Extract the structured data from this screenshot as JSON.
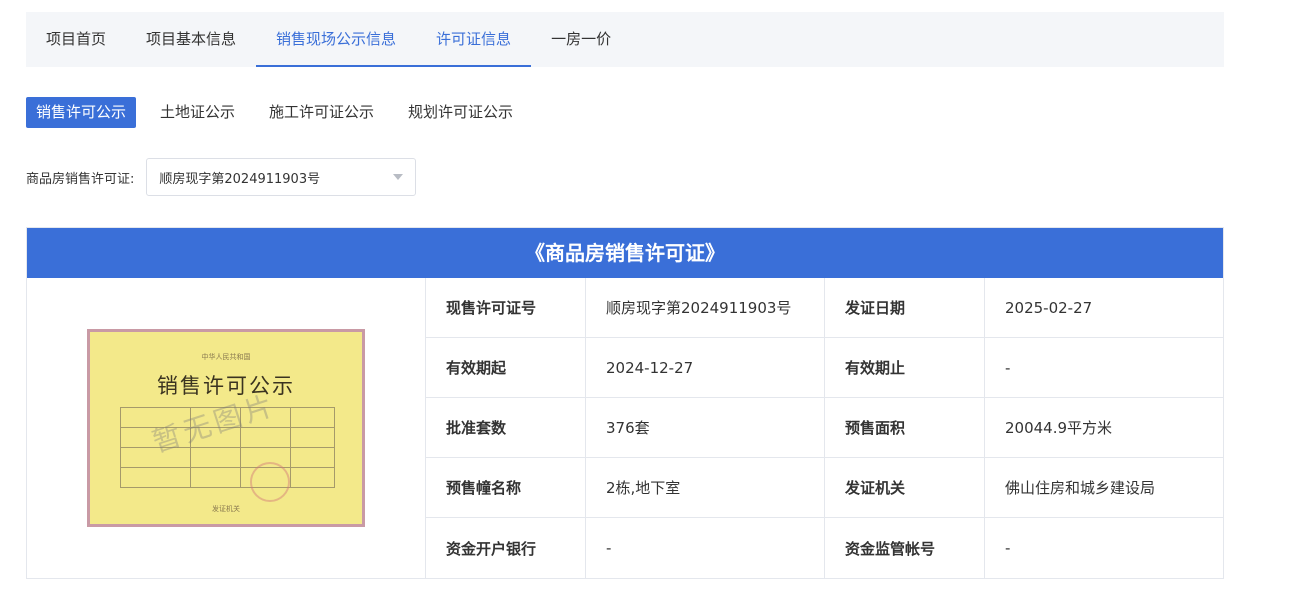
{
  "top_tabs": [
    {
      "label": "项目首页"
    },
    {
      "label": "项目基本信息"
    },
    {
      "label": "销售现场公示信息"
    },
    {
      "label": "许可证信息"
    },
    {
      "label": "一房一价"
    }
  ],
  "sub_tabs": [
    {
      "label": "销售许可公示"
    },
    {
      "label": "土地证公示"
    },
    {
      "label": "施工许可证公示"
    },
    {
      "label": "规划许可证公示"
    }
  ],
  "selector": {
    "label": "商品房销售许可证:",
    "value": "顺房现字第2024911903号"
  },
  "panel": {
    "title": "《商品房销售许可证》",
    "image": {
      "subtitle": "中华人民共和国",
      "title": "销售许可公示",
      "watermark": "暂无图片",
      "foot": "发证机关"
    },
    "rows": [
      {
        "label1": "现售许可证号",
        "value1": "顺房现字第2024911903号",
        "label2": "发证日期",
        "value2": "2025-02-27"
      },
      {
        "label1": "有效期起",
        "value1": "2024-12-27",
        "label2": "有效期止",
        "value2": "-"
      },
      {
        "label1": "批准套数",
        "value1": "376套",
        "label2": "预售面积",
        "value2": "20044.9平方米"
      },
      {
        "label1": "预售幢名称",
        "value1": "2栋,地下室",
        "label2": "发证机关",
        "value2": "佛山住房和城乡建设局"
      },
      {
        "label1": "资金开户银行",
        "value1": "-",
        "label2": "资金监管帐号",
        "value2": "-"
      }
    ]
  },
  "colors": {
    "accent": "#3a6fd8",
    "tab_bar_bg": "#f4f6f9",
    "cert_bg": "#f3e98a"
  }
}
